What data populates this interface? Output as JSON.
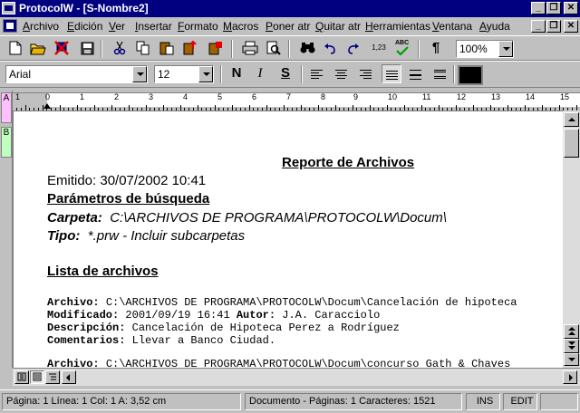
{
  "window": {
    "title": "ProtocolW - [S-Nombre2]",
    "buttons": {
      "minimize": "_",
      "restore": "❐",
      "close": "✕"
    }
  },
  "menu": {
    "items": [
      "Archivo",
      "Edición",
      "Ver",
      "Insertar",
      "Formato",
      "Macros",
      "Poner atr",
      "Quitar atr",
      "Herramientas",
      "Ventana",
      "Ayuda"
    ]
  },
  "toolbar": {
    "spell_label": "ABC",
    "counter_label": "1,23",
    "paragraph_mark": "¶",
    "zoom": "100%"
  },
  "format_bar": {
    "font": "Arial",
    "size": "12",
    "bold": "N",
    "italic": "I",
    "underline": "S",
    "color": "#000000"
  },
  "ruler": {
    "numbers": [
      "1",
      "0",
      "1",
      "2",
      "3",
      "4",
      "5",
      "6",
      "7",
      "8",
      "9",
      "10",
      "11",
      "12",
      "13",
      "14",
      "15"
    ]
  },
  "side_tabs": [
    "A",
    "B"
  ],
  "document": {
    "title": "Reporte de Archivos",
    "emitido": "Emitido: 30/07/2002 10:41",
    "params_heading": "Parámetros de búsqueda",
    "carpeta_label": "Carpeta:",
    "carpeta_value": "C:\\ARCHIVOS DE PROGRAMA\\PROTOCOLW\\Docum\\",
    "tipo_label": "Tipo:",
    "tipo_value": "*.prw  - Incluir subcarpetas",
    "list_heading": "Lista de archivos",
    "records": [
      {
        "archivo_label": "Archivo:",
        "archivo": "C:\\ARCHIVOS DE PROGRAMA\\PROTOCOLW\\Docum\\Cancelación de hipoteca",
        "modificado_label": "Modificado:",
        "modificado": "2001/09/19 16:41",
        "autor_label": "Autor:",
        "autor": "J.A. Caracciolo",
        "descripcion_label": "Descripción:",
        "descripcion": "Cancelación de Hipoteca Perez a Rodríguez",
        "comentarios_label": "Comentarios:",
        "comentarios": "Llevar a Banco Ciudad."
      },
      {
        "archivo_label": "Archivo:",
        "archivo": "C:\\ARCHIVOS DE PROGRAMA\\PROTOCOLW\\Docum\\concurso Gath & Chaves"
      }
    ]
  },
  "status": {
    "position": "Página: 1  Línea: 1 Col: 1    A: 3,52 cm",
    "document": "Documento - Páginas: 1 Caracteres: 1521",
    "ins": "INS",
    "edit": "EDIT"
  }
}
